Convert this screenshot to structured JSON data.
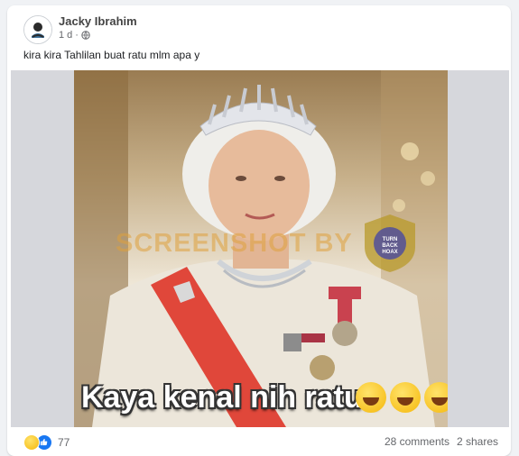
{
  "post": {
    "author": "Jacky Ibrahim",
    "time": "1 d",
    "separator": "·",
    "caption": "kira kira Tahlilan buat ratu mlm apa y"
  },
  "media": {
    "watermark": "SCREENSHOT BY",
    "seal_text": "TURN BACK HOAX",
    "meme_caption": "Kaya kenal nih ratu..",
    "emoji": "rolling-on-floor-laughing"
  },
  "footer": {
    "reaction_count": "77",
    "comments": "28 comments",
    "shares": "2 shares"
  },
  "colors": {
    "sash": "#e0473a",
    "accent_blue": "#1877f2"
  }
}
